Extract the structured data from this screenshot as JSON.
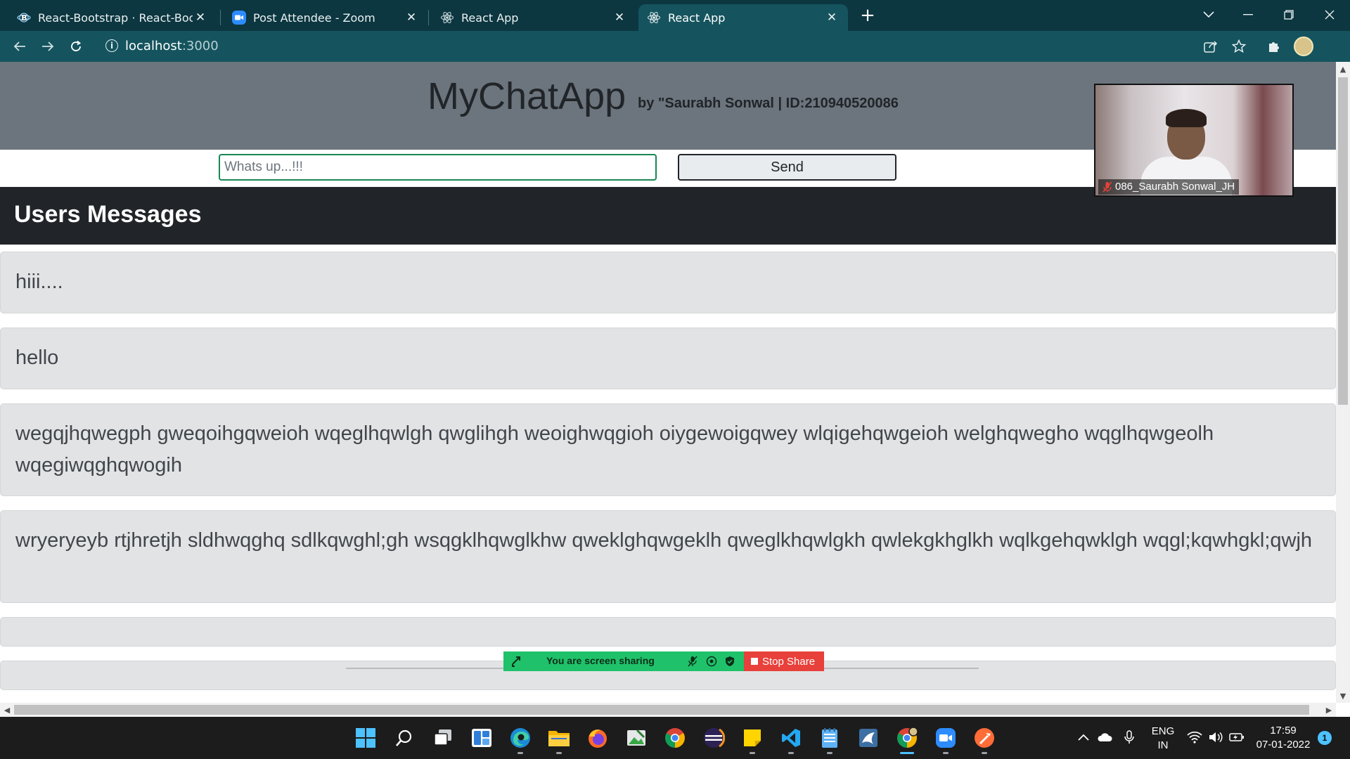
{
  "browser": {
    "tabs": [
      {
        "title": "React-Bootstrap · React-Bootstrap Documentation",
        "favicon": "bootstrap-icon"
      },
      {
        "title": "Post Attendee - Zoom",
        "favicon": "zoom-icon"
      },
      {
        "title": "React App",
        "favicon": "react-icon"
      },
      {
        "title": "React App",
        "favicon": "react-icon",
        "active": true
      }
    ],
    "url_host": "localhost",
    "url_port": ":3000"
  },
  "app": {
    "title": "MyChatApp",
    "byline": "by \"Saurabh Sonwal | ID:210940520086",
    "input_placeholder": "Whats up...!!!",
    "send_label": "Send",
    "section_title": "Users Messages",
    "messages": [
      "hiii....",
      "hello",
      "wegqjhqwegph gweqoihgqweioh wqeglhqwlgh qwglihgh weoighwqgioh oiygewoigqwey wlqigehqwgeioh welghqwegho wqglhqwgeolh wqegiwqghqwogih",
      "wryeryeyb rtjhretjh sldhwqghq sdlkqwghl;gh wsqgklhqwglkhw qweklghqwgeklh qweglkhqwlgkh qwlekgkhglkh wqlkgehqwklgh wqgl;kqwhgkl;qwjh",
      "",
      ""
    ]
  },
  "zoom": {
    "participant_name": "086_Saurabh Sonwal_JH",
    "share_status": "You are screen sharing",
    "stop_share_label": "Stop Share"
  },
  "taskbar": {
    "language_line1": "ENG",
    "language_line2": "IN",
    "time": "17:59",
    "date": "07-01-2022",
    "notification_count": "1"
  },
  "colors": {
    "header_bg": "#6c757d",
    "section_bg": "#212529",
    "message_bg": "#e2e3e5",
    "input_border": "#198754",
    "chrome_frame": "#0c3640",
    "chrome_toolbar": "#15545e",
    "share_green": "#1fc26a",
    "stop_red": "#e8403a"
  }
}
